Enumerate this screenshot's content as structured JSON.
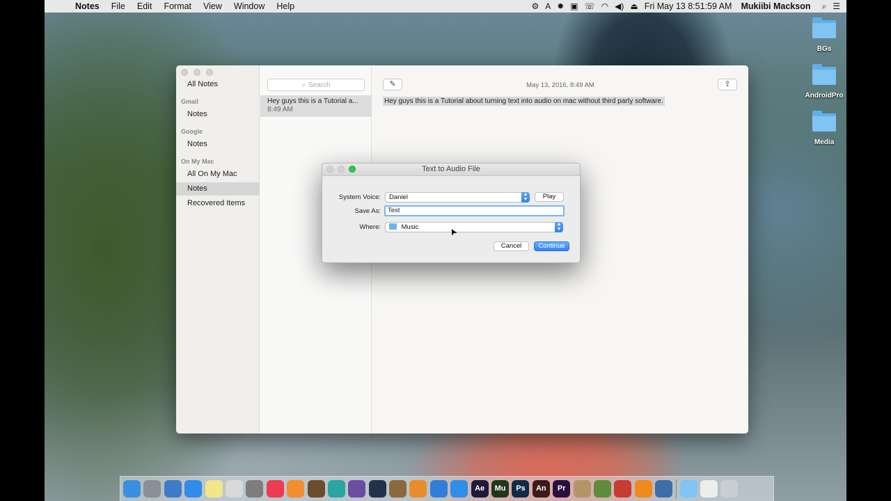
{
  "menubar": {
    "apple": "",
    "app_name": "Notes",
    "menus": [
      "File",
      "Edit",
      "Format",
      "View",
      "Window",
      "Help"
    ],
    "clock": "Fri May 13  8:51:59 AM",
    "user": "Mukiibi Mackson"
  },
  "desktop": {
    "items": [
      "BGs",
      "AndroidPro",
      "Media"
    ]
  },
  "notes": {
    "sidebar": {
      "all_notes": "All Notes",
      "gmail_header": "Gmail",
      "gmail_notes": "Notes",
      "google_header": "Google",
      "google_notes": "Notes",
      "onmymac_header": "On My Mac",
      "all_on_my_mac": "All On My Mac",
      "mac_notes": "Notes",
      "recovered": "Recovered Items"
    },
    "search_placeholder": "Search",
    "note": {
      "title": "Hey guys this is a Tutorial a...",
      "time": "8:49 AM"
    },
    "date": "May 13, 2016, 8:49 AM",
    "body": "Hey guys this is a Tutorial about turning text into audio on mac without third party software."
  },
  "dialog": {
    "title": "Text to Audio File",
    "voice_label": "System Voice:",
    "voice_value": "Daniel",
    "play": "Play",
    "saveas_label": "Save As:",
    "saveas_value": "Test",
    "where_label": "Where:",
    "where_value": "Music",
    "cancel": "Cancel",
    "continue": "Continue"
  },
  "dock": {
    "icons": [
      {
        "name": "finder-icon",
        "color": "#3b8fe0",
        "glyph": ""
      },
      {
        "name": "launchpad-icon",
        "color": "#8a8f97",
        "glyph": ""
      },
      {
        "name": "preview-icon",
        "color": "#3f7bc9",
        "glyph": ""
      },
      {
        "name": "safari-icon",
        "color": "#2f8ce8",
        "glyph": ""
      },
      {
        "name": "notes-icon",
        "color": "#f4e48a",
        "glyph": ""
      },
      {
        "name": "photos-icon",
        "color": "#d9d9d9",
        "glyph": ""
      },
      {
        "name": "system-preferences-icon",
        "color": "#7d7d7d",
        "glyph": ""
      },
      {
        "name": "itunes-icon",
        "color": "#ec3b52",
        "glyph": ""
      },
      {
        "name": "ibooks-icon",
        "color": "#f18f2e",
        "glyph": ""
      },
      {
        "name": "garageband-icon",
        "color": "#6a4e2c",
        "glyph": ""
      },
      {
        "name": "app-icon-teal",
        "color": "#2aa5a0",
        "glyph": ""
      },
      {
        "name": "app-icon-purple",
        "color": "#6b4ca3",
        "glyph": ""
      },
      {
        "name": "app-icon-dark",
        "color": "#24314a",
        "glyph": ""
      },
      {
        "name": "app-icon-brown",
        "color": "#8a6a3c",
        "glyph": ""
      },
      {
        "name": "blender-icon",
        "color": "#e98c2c",
        "glyph": ""
      },
      {
        "name": "app-icon-blue",
        "color": "#2f7ed8",
        "glyph": ""
      },
      {
        "name": "app-store-icon",
        "color": "#2f8ee8",
        "glyph": ""
      },
      {
        "name": "after-effects-icon",
        "color": "#1f1a3a",
        "glyph": "Ae"
      },
      {
        "name": "muse-icon",
        "color": "#203819",
        "glyph": "Mu"
      },
      {
        "name": "photoshop-icon",
        "color": "#0f2b45",
        "glyph": "Ps"
      },
      {
        "name": "animate-icon",
        "color": "#3d1a18",
        "glyph": "An"
      },
      {
        "name": "premiere-icon",
        "color": "#2a1040",
        "glyph": "Pr"
      },
      {
        "name": "app-icon-tan",
        "color": "#b59566",
        "glyph": ""
      },
      {
        "name": "android-studio-icon",
        "color": "#5f8c3a",
        "glyph": ""
      },
      {
        "name": "app-icon-red",
        "color": "#c73b30",
        "glyph": ""
      },
      {
        "name": "vlc-icon",
        "color": "#f08a1c",
        "glyph": ""
      },
      {
        "name": "clapper-icon",
        "color": "#3d6ea8",
        "glyph": ""
      },
      {
        "name": "folder-icon",
        "color": "#7fc4f2",
        "glyph": ""
      },
      {
        "name": "document-icon",
        "color": "#ededed",
        "glyph": ""
      },
      {
        "name": "trash-icon",
        "color": "#c8ced4",
        "glyph": ""
      }
    ]
  }
}
